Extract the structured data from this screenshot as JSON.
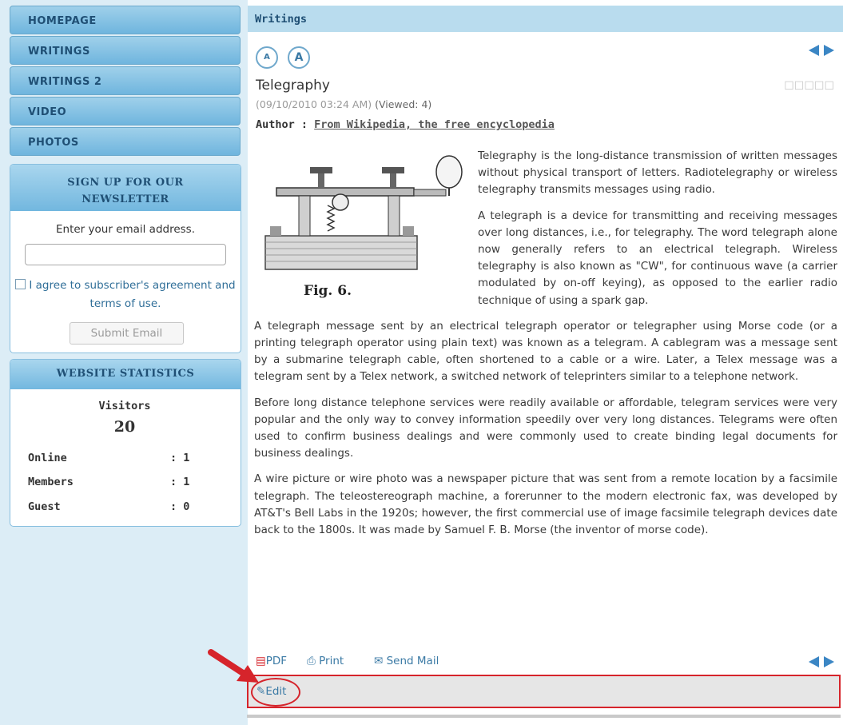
{
  "nav": {
    "items": [
      {
        "label": "HOMEPAGE"
      },
      {
        "label": "WRITINGS"
      },
      {
        "label": "WRITINGS 2"
      },
      {
        "label": "VIDEO"
      },
      {
        "label": "PHOTOS"
      }
    ]
  },
  "newsletter": {
    "title": "SIGN UP FOR OUR NEWSLETTER",
    "prompt": "Enter your email address.",
    "email_value": "",
    "agree_text": "I agree to subscriber's agreement and terms of use.",
    "submit_label": "Submit Email"
  },
  "stats": {
    "title": "WEBSITE STATISTICS",
    "visitors_label": "Visitors",
    "visitors_value": "20",
    "rows": [
      {
        "label": "Online",
        "value": ": 1"
      },
      {
        "label": "Members",
        "value": ": 1"
      },
      {
        "label": "Guest",
        "value": ": 0"
      }
    ]
  },
  "main": {
    "section_title": "Writings",
    "font_small": "A",
    "font_large": "A",
    "article": {
      "title": "Telegraphy",
      "datetime": "(09/10/2010 03:24 AM)",
      "viewed": "(Viewed: 4)",
      "author_label": "Author :",
      "author_name": "From Wikipedia, the free encyclopedia",
      "figure_caption": "Fig. 6.",
      "paragraphs": [
        "Telegraphy is the long-distance transmission of written messages without physical transport of letters. Radiotelegraphy or wireless telegraphy transmits messages using radio.",
        "A telegraph is a device for transmitting and receiving messages over long distances, i.e., for telegraphy. The word telegraph alone now generally refers to an electrical telegraph. Wireless telegraphy is also known as \"CW\", for continuous wave (a carrier modulated by on-off keying), as opposed to the earlier radio technique of using a spark gap.",
        "A telegraph message sent by an electrical telegraph operator or telegrapher using Morse code (or a printing telegraph operator using plain text) was known as a telegram. A cablegram was a message sent by a submarine telegraph cable, often shortened to a cable or a wire. Later, a Telex message was a telegram sent by a Telex network, a switched network of teleprinters similar to a telephone network.",
        "Before long distance telephone services were readily available or affordable, telegram services were very popular and the only way to convey information speedily over very long distances. Telegrams were often used to confirm business dealings and were commonly used to create binding legal documents for business dealings.",
        "A wire picture or wire photo was a newspaper picture that was sent from a remote location by a facsimile telegraph. The teleostereograph machine, a forerunner to the modern electronic fax, was developed by AT&T's Bell Labs in the 1920s; however, the first commercial use of image facsimile telegraph devices date back to the 1800s. It was made by Samuel F. B. Morse (the inventor of morse code)."
      ]
    },
    "actions": {
      "pdf": "PDF",
      "print": "Print",
      "send_mail": "Send Mail",
      "edit": "Edit"
    }
  },
  "colors": {
    "nav_bg": "#6fb5de",
    "sidebar_bg": "#dcedf6",
    "header_bg": "#b9dcee",
    "highlight_red": "#d6242b",
    "link_blue": "#3b7aa5"
  }
}
